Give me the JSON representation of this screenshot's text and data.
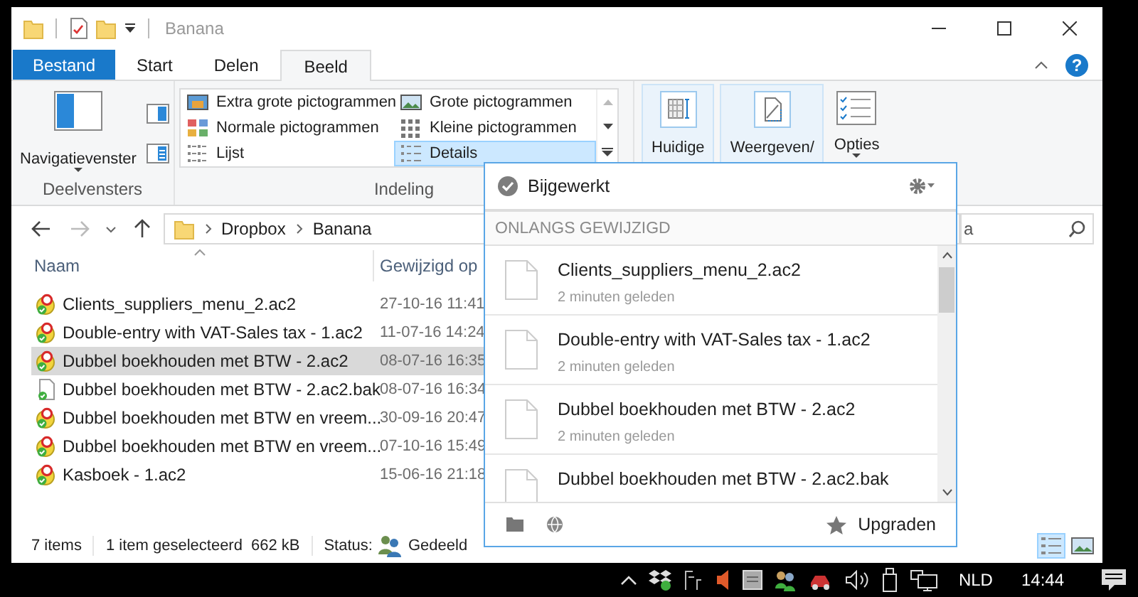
{
  "window": {
    "title": "Banana"
  },
  "ribbon_tabs": [
    {
      "label": "Bestand",
      "kind": "file",
      "selected": false
    },
    {
      "label": "Start",
      "kind": "tab",
      "selected": false
    },
    {
      "label": "Delen",
      "kind": "tab",
      "selected": false
    },
    {
      "label": "Beeld",
      "kind": "tab",
      "selected": true
    }
  ],
  "help": "?",
  "panes_group": {
    "label": "Deelvensters",
    "button": "Navigatievenster"
  },
  "layout_group": {
    "label": "Indeling",
    "options": [
      {
        "label": "Extra grote pictogrammen",
        "kind": "extra_large",
        "selected": false
      },
      {
        "label": "Grote pictogrammen",
        "kind": "large",
        "selected": false
      },
      {
        "label": "Normale pictogrammen",
        "kind": "medium",
        "selected": false
      },
      {
        "label": "Kleine pictogrammen",
        "kind": "small",
        "selected": false
      },
      {
        "label": "Lijst",
        "kind": "list",
        "selected": false
      },
      {
        "label": "Details",
        "kind": "details",
        "selected": true
      }
    ]
  },
  "view_buttons": [
    {
      "label": "Huidige",
      "kind": "current"
    },
    {
      "label": "Weergeven/",
      "kind": "show"
    },
    {
      "label": "Opties",
      "kind": "options"
    }
  ],
  "address": {
    "path": [
      "Dropbox",
      "Banana"
    ]
  },
  "search": {
    "value": "a"
  },
  "columns": [
    "Naam",
    "Gewijzigd op"
  ],
  "files": [
    {
      "name": "Clients_suppliers_menu_2.ac2",
      "modified": "27-10-16 11:41",
      "kind": "ac2",
      "selected": false
    },
    {
      "name": "Double-entry with VAT-Sales tax - 1.ac2",
      "modified": "11-07-16 14:24",
      "kind": "ac2",
      "selected": false
    },
    {
      "name": "Dubbel boekhouden met BTW - 2.ac2",
      "modified": "08-07-16 16:35",
      "kind": "ac2",
      "selected": true
    },
    {
      "name": "Dubbel boekhouden met BTW - 2.ac2.bak",
      "modified": "08-07-16 16:34",
      "kind": "bak",
      "selected": false
    },
    {
      "name": "Dubbel boekhouden met BTW en vreem...",
      "modified": "30-09-16 20:47",
      "kind": "ac2",
      "selected": false
    },
    {
      "name": "Dubbel boekhouden met BTW en vreem...",
      "modified": "07-10-16 15:49",
      "kind": "ac2",
      "selected": false
    },
    {
      "name": "Kasboek - 1.ac2",
      "modified": "15-06-16 21:18",
      "kind": "ac2",
      "selected": false
    }
  ],
  "status_bar": {
    "count": "7 items",
    "selection": "1 item geselecteerd",
    "size": "662 kB",
    "status_label": "Status:",
    "status": "Gedeeld"
  },
  "dropbox": {
    "status": "Bijgewerkt",
    "section": "ONLANGS GEWIJZIGD",
    "recent": [
      {
        "name": "Clients_suppliers_menu_2.ac2",
        "time": "2 minuten geleden"
      },
      {
        "name": "Double-entry with VAT-Sales tax - 1.ac2",
        "time": "2 minuten geleden"
      },
      {
        "name": "Dubbel boekhouden met BTW - 2.ac2",
        "time": "2 minuten geleden"
      },
      {
        "name": "Dubbel boekhouden met BTW - 2.ac2.bak"
      }
    ],
    "upgrade": "Upgraden"
  },
  "taskbar": {
    "language": "NLD",
    "time": "14:44"
  }
}
